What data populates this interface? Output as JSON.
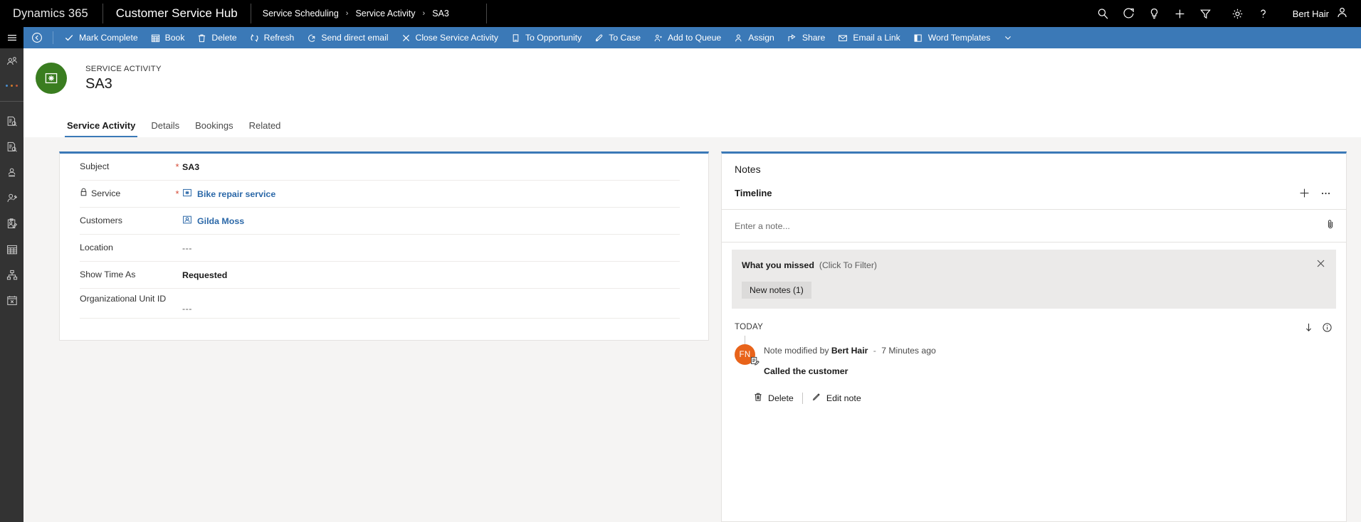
{
  "topbar": {
    "brand": "Dynamics 365",
    "app_title": "Customer Service Hub",
    "breadcrumb": [
      "Service Scheduling",
      "Service Activity",
      "SA3"
    ],
    "breadcrumb_separator": "›",
    "icons": [
      {
        "name": "search-icon",
        "label": "Search"
      },
      {
        "name": "assistant-icon",
        "label": "Assistant"
      },
      {
        "name": "lightbulb-icon",
        "label": "Insights"
      },
      {
        "name": "plus-icon",
        "label": "Quick Create"
      },
      {
        "name": "filter-icon",
        "label": "Filter"
      },
      {
        "name": "gear-icon",
        "label": "Settings"
      },
      {
        "name": "help-icon",
        "label": "Help"
      }
    ],
    "user_name": "Bert Hair"
  },
  "commandbar": {
    "background": "#3b79b7",
    "back_icon": "back-circle-icon",
    "buttons": [
      {
        "label": "Mark Complete",
        "icon": "check-icon"
      },
      {
        "label": "Book",
        "icon": "calendar-book-icon"
      },
      {
        "label": "Delete",
        "icon": "trash-icon"
      },
      {
        "label": "Refresh",
        "icon": "refresh-icon"
      },
      {
        "label": "Send direct email",
        "icon": "send-email-icon"
      },
      {
        "label": "Close Service Activity",
        "icon": "close-x-icon"
      },
      {
        "label": "To Opportunity",
        "icon": "opportunity-icon"
      },
      {
        "label": "To Case",
        "icon": "case-icon"
      },
      {
        "label": "Add to Queue",
        "icon": "add-to-queue-icon"
      },
      {
        "label": "Assign",
        "icon": "assign-person-icon"
      },
      {
        "label": "Share",
        "icon": "share-icon"
      },
      {
        "label": "Email a Link",
        "icon": "email-link-icon"
      },
      {
        "label": "Word Templates",
        "icon": "word-icon",
        "has_chevron": true
      }
    ]
  },
  "sidenav": {
    "hamburger": "hamburger-icon",
    "items": [
      {
        "name": "sidebar-item-recent-contact",
        "icon": "contact-recent-icon"
      },
      {
        "name": "sidebar-item-more",
        "icon": "more-dots-icon"
      },
      {
        "name": "sidebar-item-case-lookup",
        "icon": "case-search-icon"
      },
      {
        "name": "sidebar-item-article-lookup",
        "icon": "article-search-icon"
      },
      {
        "name": "sidebar-item-account",
        "icon": "account-icon"
      },
      {
        "name": "sidebar-item-contact-search",
        "icon": "contact-search-icon"
      },
      {
        "name": "sidebar-item-queue",
        "icon": "clipboard-edit-icon"
      },
      {
        "name": "sidebar-item-calendar",
        "icon": "calendar-icon"
      },
      {
        "name": "sidebar-item-hierarchy",
        "icon": "hierarchy-icon"
      },
      {
        "name": "sidebar-item-service-activity",
        "icon": "calendar-x-icon"
      }
    ]
  },
  "record": {
    "icon": "service-activity-icon",
    "icon_color": "#3a7d20",
    "kicker": "SERVICE ACTIVITY",
    "title": "SA3"
  },
  "tabs": [
    {
      "label": "Service Activity",
      "active": true
    },
    {
      "label": "Details",
      "active": false
    },
    {
      "label": "Bookings",
      "active": false
    },
    {
      "label": "Related",
      "active": false
    }
  ],
  "form": {
    "fields": [
      {
        "label": "Subject",
        "required": true,
        "locked": false,
        "value": "SA3",
        "type": "bold"
      },
      {
        "label": "Service",
        "required": true,
        "locked": true,
        "value": "Bike repair service",
        "type": "link",
        "icon": "service-icon"
      },
      {
        "label": "Customers",
        "required": false,
        "locked": false,
        "value": "Gilda Moss",
        "type": "link",
        "icon": "contact-icon"
      },
      {
        "label": "Location",
        "required": false,
        "locked": false,
        "value": "---",
        "type": "dash"
      },
      {
        "label": "Show Time As",
        "required": false,
        "locked": false,
        "value": "Requested",
        "type": "bold"
      },
      {
        "label": "Organizational Unit ID",
        "required": false,
        "locked": false,
        "value": "---",
        "type": "dash"
      }
    ]
  },
  "timeline": {
    "notes_label": "Notes",
    "title": "Timeline",
    "add_icon": "plus-icon",
    "more_icon": "ellipsis-icon",
    "note_placeholder": "Enter a note...",
    "attach_icon": "paperclip-icon",
    "missed": {
      "title": "What you missed",
      "subtitle": "(Click To Filter)",
      "close_icon": "close-x-icon",
      "chip": "New notes (1)"
    },
    "today_label": "TODAY",
    "sort_icon": "sort-down-icon",
    "info_icon": "info-icon",
    "entry": {
      "avatar_initials": "FN",
      "avatar_color": "#e8631a",
      "badge_icon": "note-edit-icon",
      "prefix": "Note modified by",
      "author": "Bert Hair",
      "separator": "-",
      "time": "7 Minutes ago",
      "text": "Called the customer",
      "actions": [
        {
          "label": "Delete",
          "icon": "trash-icon"
        },
        {
          "label": "Edit note",
          "icon": "pencil-icon"
        }
      ]
    }
  }
}
